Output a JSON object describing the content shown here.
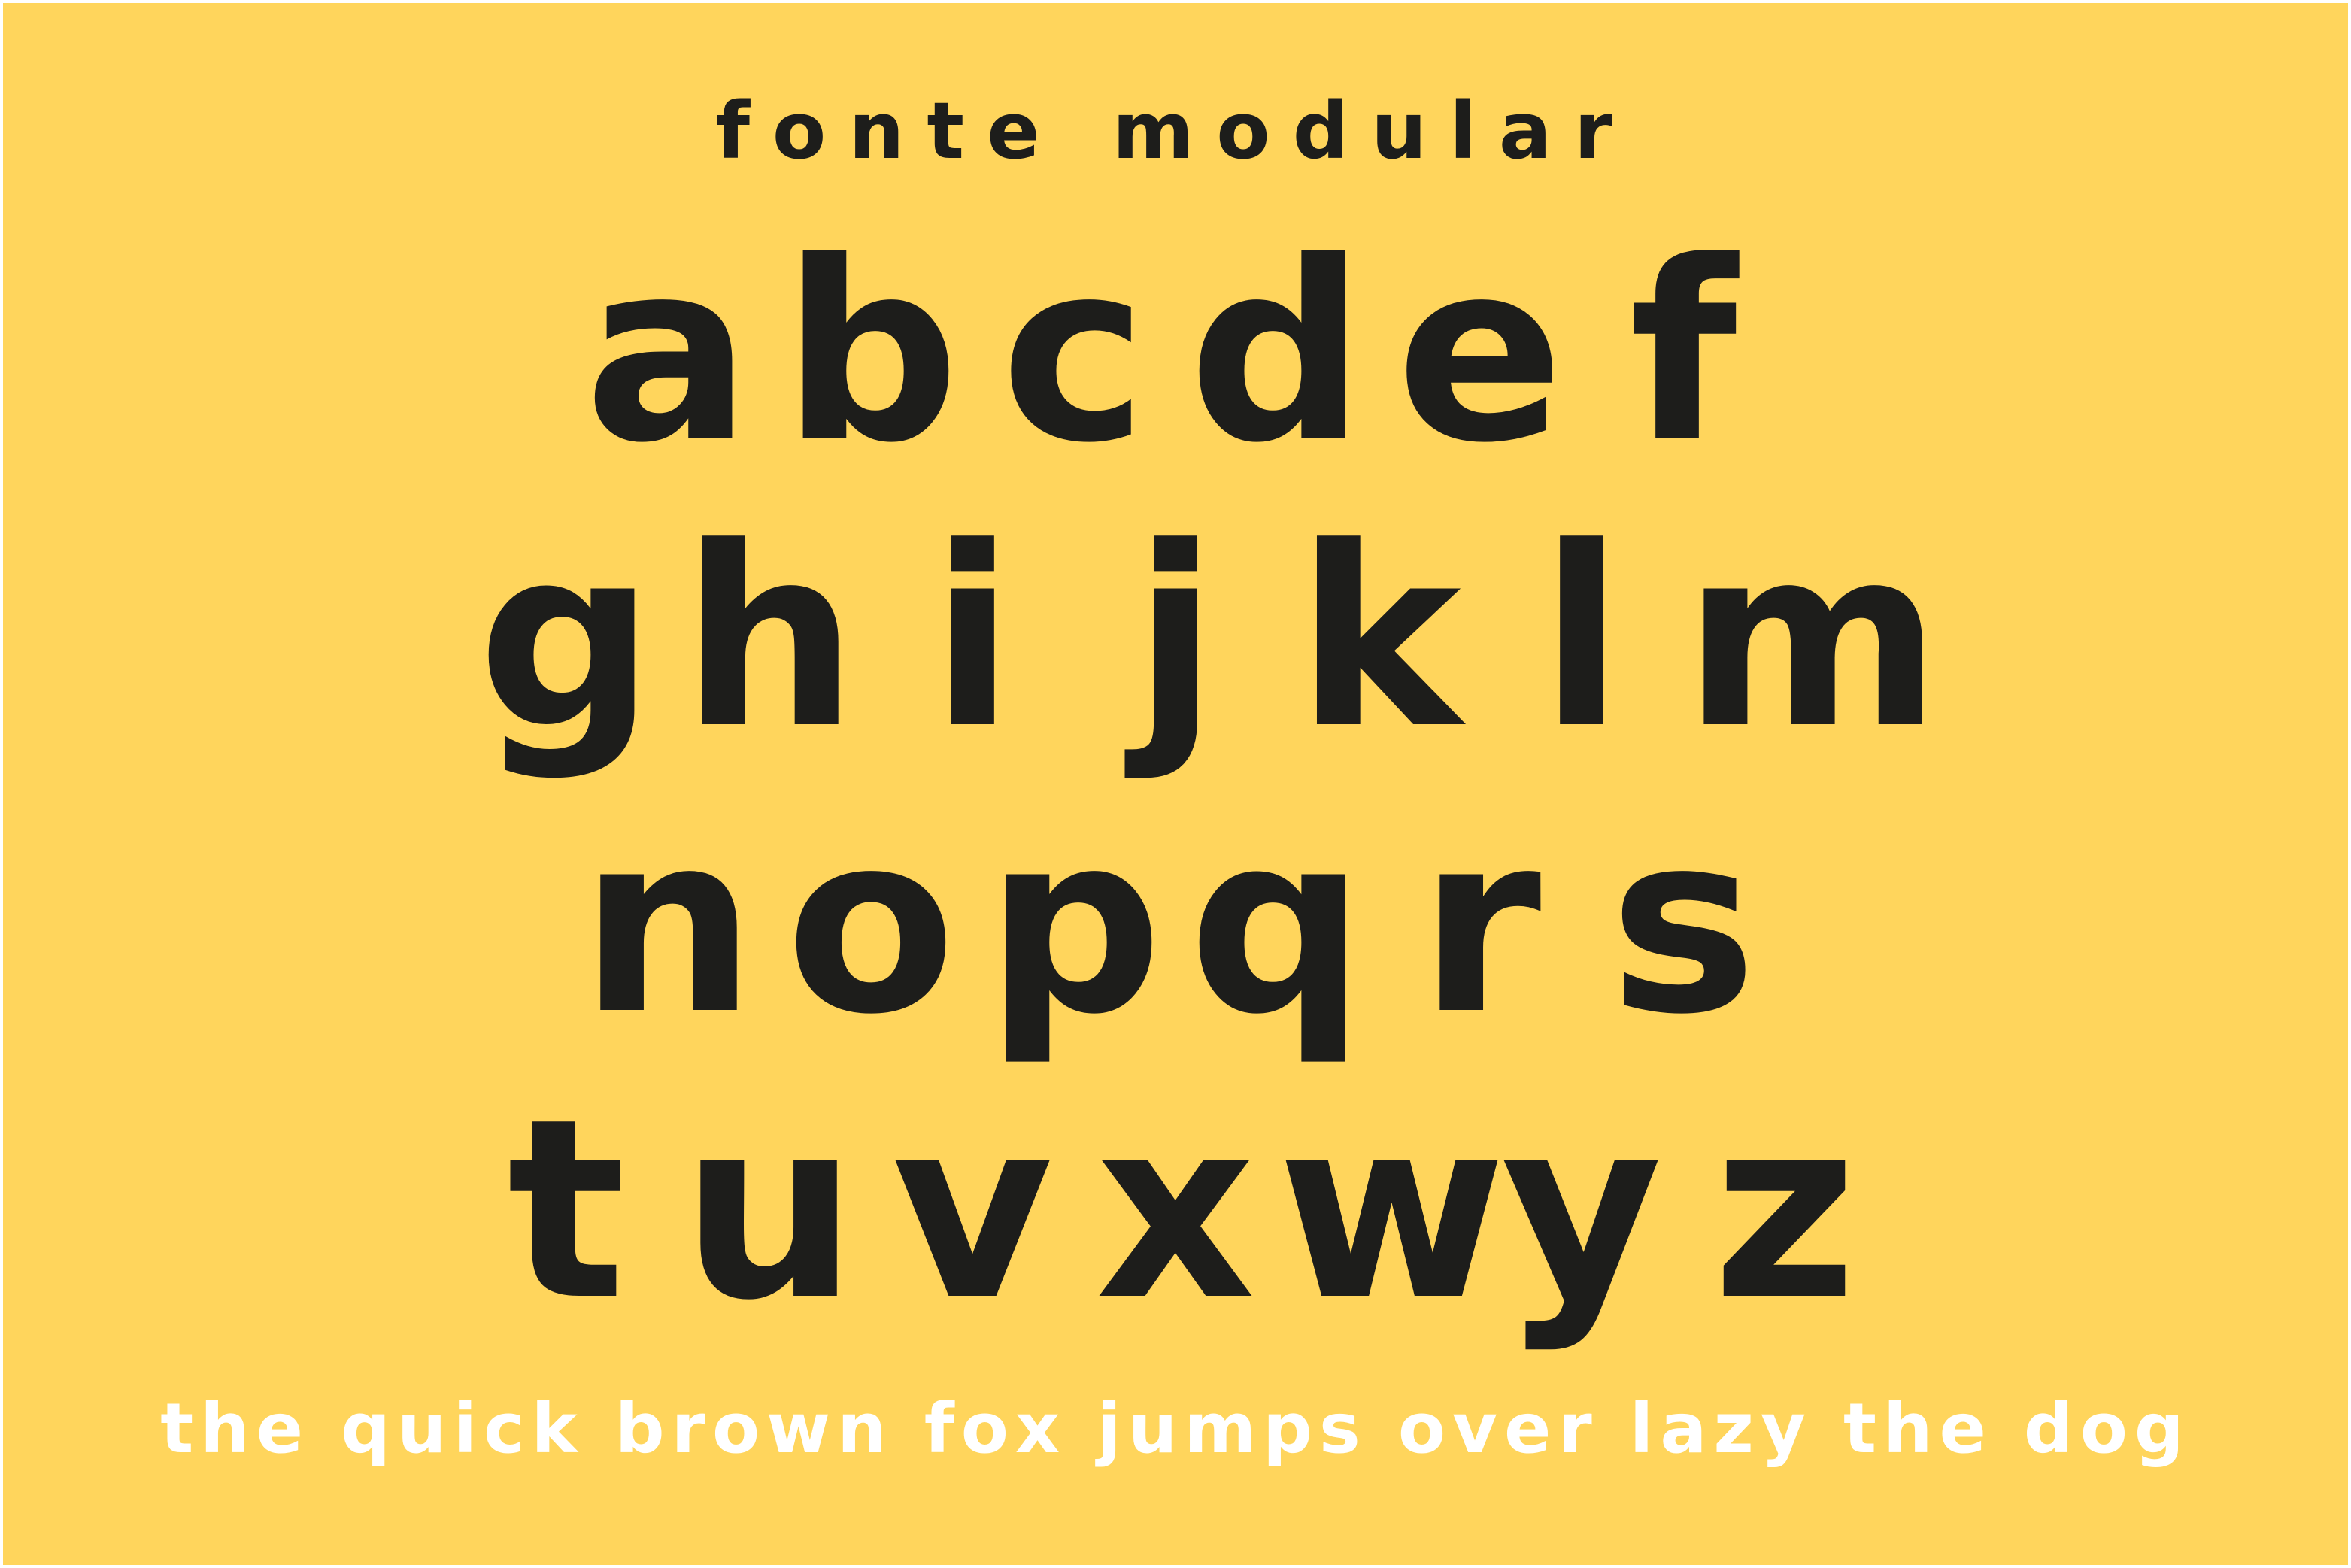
{
  "colors": {
    "background": "#FFD55C",
    "ink": "#1D1D1B",
    "pangram_text": "#FFFFFF",
    "frame": "#FFFFFF"
  },
  "title": "fonte modular",
  "alphabet": {
    "row_1": [
      "a",
      "b",
      "c",
      "d",
      "e",
      "f"
    ],
    "row_2": [
      "g",
      "h",
      "i",
      "j",
      "k",
      "l",
      "m"
    ],
    "row_3": [
      "n",
      "o",
      "p",
      "q",
      "r",
      "s"
    ],
    "row_4": [
      "t",
      "u",
      "v",
      "x",
      "w",
      "y",
      "z"
    ]
  },
  "pangram": "the quick brown fox jumps over lazy the dog"
}
